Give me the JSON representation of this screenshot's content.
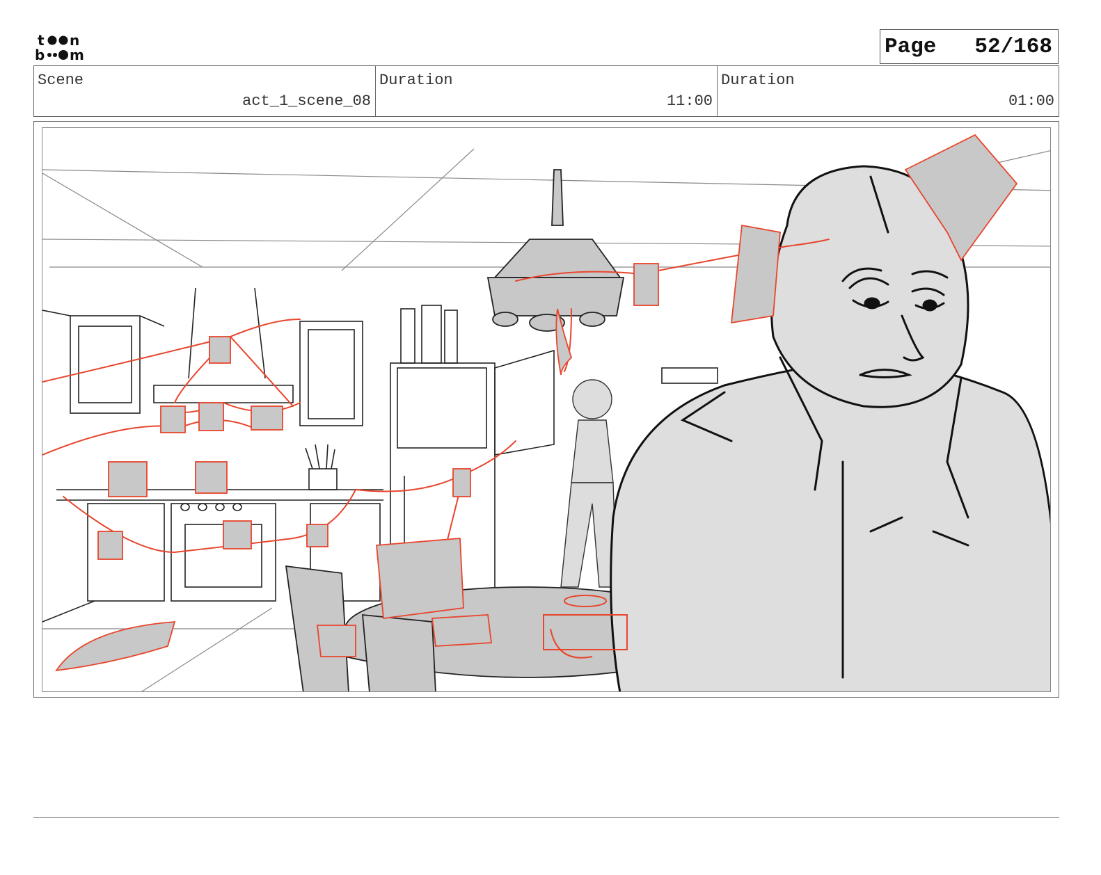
{
  "brand": {
    "logo_text_top": "toon",
    "logo_text_bottom": "boom"
  },
  "page_indicator": {
    "label": "Page",
    "value": "52/168"
  },
  "header": {
    "scene_label": "Scene",
    "scene_value": "act_1_scene_08",
    "duration1_label": "Duration",
    "duration1_value": "11:00",
    "duration2_label": "Duration",
    "duration2_value": "01:00"
  },
  "colors": {
    "annotation_red": "#e8452c",
    "sketch_gray": "#c8c8c8",
    "ink": "#111111"
  }
}
